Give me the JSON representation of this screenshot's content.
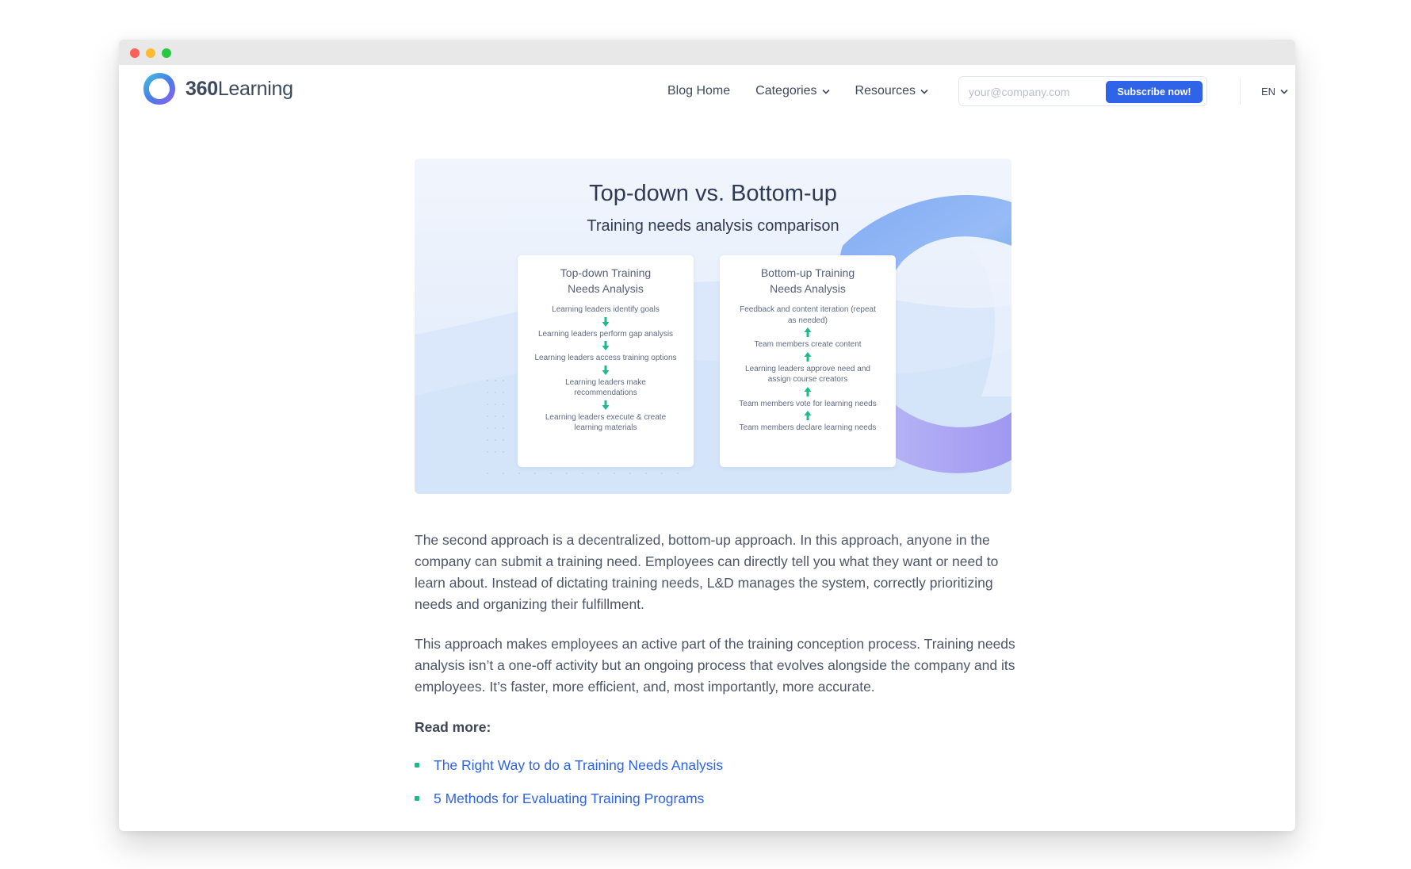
{
  "window": {
    "controls": [
      "close",
      "minimize",
      "maximize"
    ]
  },
  "brand": {
    "logo_bold": "360",
    "logo_rest": "Learning",
    "logo_icon": "360learning-ring-icon",
    "accent": "#2f63e8"
  },
  "nav": {
    "links": [
      {
        "label": "Blog Home"
      },
      {
        "label": "Categories"
      },
      {
        "label": "Resources"
      }
    ],
    "subscribe": {
      "placeholder": "your@company.com",
      "value": "",
      "button": "Subscribe now!"
    },
    "language": "EN"
  },
  "hero": {
    "title": "Top-down vs. Bottom-up",
    "subtitle": "Training needs analysis comparison",
    "left_card": {
      "title": "Top-down Training Needs Analysis",
      "steps": [
        "Learning leaders identify goals",
        "Learning leaders perform gap analysis",
        "Learning leaders access training options",
        "Learning leaders make recommendations",
        "Learning leaders execute & create learning materials"
      ]
    },
    "right_card": {
      "title": "Bottom-up Training Needs Analysis",
      "steps": [
        "Feedback and content iteration (repeat as needed)",
        "Team members create content",
        "Learning leaders approve need and assign course creators",
        "Team members vote for learning needs",
        "Team members declare learning needs"
      ]
    },
    "arrow_color": "#1fb98e"
  },
  "article": {
    "paragraphs": [
      "The second approach is a decentralized, bottom-up approach. In this approach, anyone in the company can submit a training need. Employees can directly tell you what they want or need to learn about. Instead of dictating training needs, L&D manages the system, correctly prioritizing needs and organizing their fulfillment.",
      "This approach makes employees an active part of the training conception process. Training needs analysis isn’t a one-off activity but an ongoing process that evolves alongside the company and its employees. It’s faster, more efficient, and, most importantly, more accurate."
    ],
    "read_more_label": "Read more:",
    "links": [
      "The Right Way to do a Training Needs Analysis",
      "5 Methods for Evaluating Training Programs"
    ]
  }
}
